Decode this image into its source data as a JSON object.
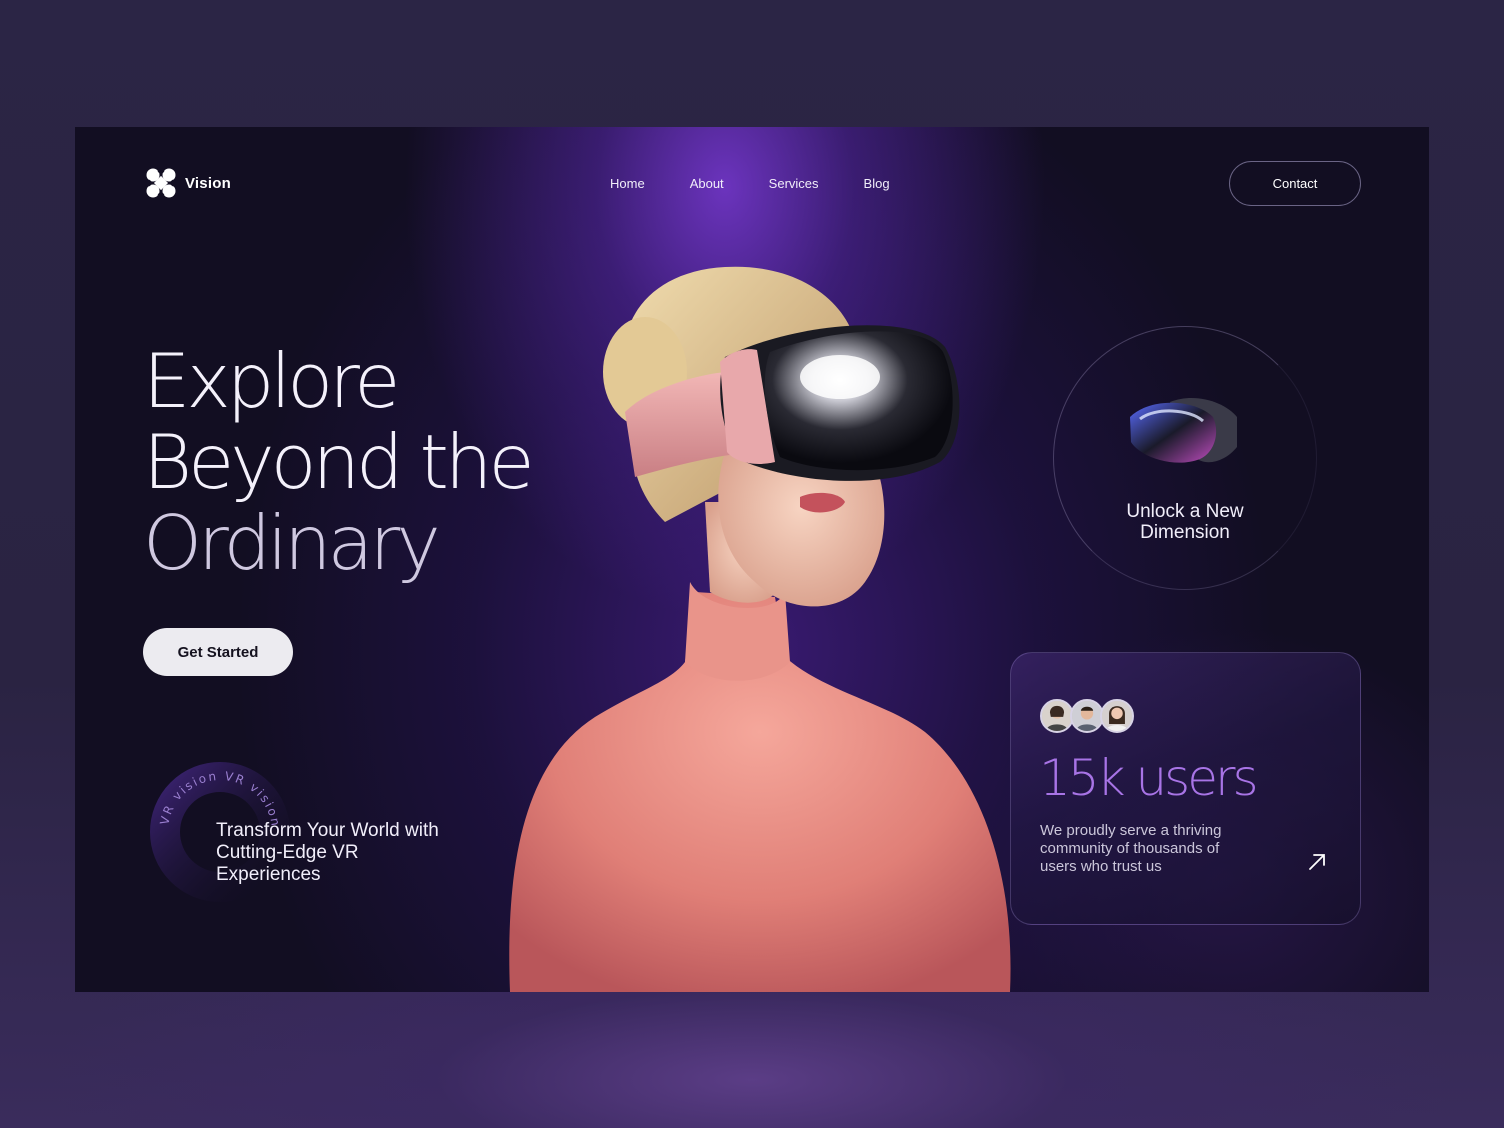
{
  "brand": {
    "name": "Vision",
    "logo_icon": "x-petal-logo-icon"
  },
  "nav": {
    "items": [
      "Home",
      "About",
      "Services",
      "Blog"
    ],
    "contact_label": "Contact"
  },
  "hero": {
    "headline": [
      "Explore",
      "Beyond the",
      "Ordinary"
    ],
    "cta_label": "Get Started",
    "ring_text": "VR vision VR vision",
    "tagline": "Transform Your World with Cutting-Edge VR Experiences"
  },
  "feature": {
    "title": "Unlock a New Dimension",
    "icon": "vr-headset-icon"
  },
  "users_card": {
    "count": "15k users",
    "description": "We proudly serve a thriving community of thousands of users who trust us",
    "arrow_icon": "arrow-up-right-icon"
  },
  "colors": {
    "accent": "#a874e6",
    "background": "#120e22",
    "glow": "#7a3ad6",
    "shirt": "#e88a80"
  }
}
